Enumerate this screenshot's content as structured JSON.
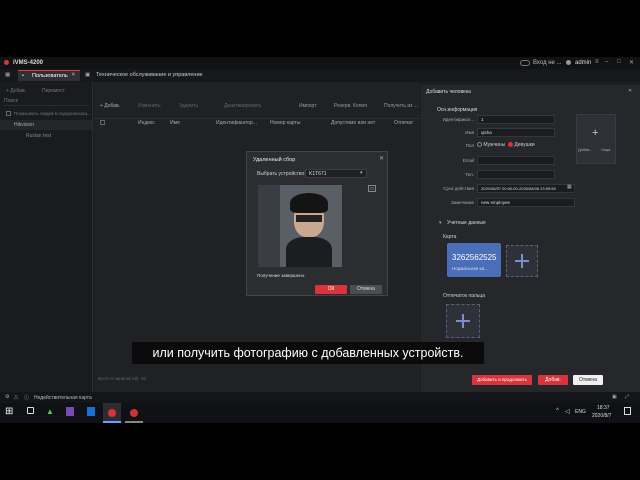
{
  "app": {
    "title": "iVMS-4200",
    "user": "admin",
    "login_status": "Вход не ..."
  },
  "tabs": {
    "active": "Пользователь",
    "maintenance": "Техническое обслуживание и управление"
  },
  "sidebar": {
    "add_label": "+ Добав.",
    "edit_label": "Перемест.",
    "search_placeholder": "Поиск",
    "show_hint": "Показывать людей в подорганизац...",
    "org_root": "Hikvision",
    "org_child": "Ruslan test"
  },
  "toolbar": {
    "add": "+ Добав.",
    "change": "Изменить",
    "remove": "Удалить",
    "disable": "Деактивировать",
    "import": "Импорт",
    "reset": "Резерв. Копия",
    "get": "Получить из ..."
  },
  "table": {
    "columns": [
      "Индекс",
      "Имя",
      "Идентификатор...",
      "Номер карты",
      "Допустимо или нет",
      "Отпечат"
    ]
  },
  "pagination": {
    "summary": "Всего 0 записи(-ей)",
    "per_page": "20"
  },
  "status_bar": {
    "text": "Недействительная карта"
  },
  "dialog": {
    "title": "Удаленный сбор",
    "device_label": "Выбрать устройство:",
    "device_value": "K1T671",
    "status": "Получение завершено.",
    "ok": "ОК",
    "cancel": "Отмена"
  },
  "panel": {
    "title": "Добавить человека",
    "basic_section": "Осн.информация",
    "id_label": "Идентификат...",
    "id_value": "1",
    "name_label": "Имя",
    "name_value": "qisha",
    "gender_label": "Пол",
    "male": "Мужчины",
    "female": "Девушки",
    "email_label": "Email",
    "email_value": "",
    "phone_label": "Тел.",
    "phone_value": "",
    "validity_label": "Срок действия",
    "validity_value": "2020/08/07 00:00:00-2030/08/06 23:59:59",
    "remark_label": "Замечание",
    "remark_value": "new employee",
    "add_face_label": "Добав...",
    "face_suffix": "Лица",
    "credentials_section": "Учетные данные",
    "card_label": "Карта",
    "card_number": "3262562525",
    "card_type": "Нормальная ка...",
    "fingerprint_label": "Отпечаток пальца",
    "btn_add_continue": "Добавить и продолжить",
    "btn_add": "Добав.",
    "btn_cancel": "Отмена"
  },
  "subtitle": "или получить фотографию с добавленных устройств.",
  "taskbar": {
    "language": "ENG",
    "time": "18:37",
    "date": "2020/8/7"
  },
  "colors": {
    "accent": "#d9343c",
    "card": "#4a6fb8",
    "background": "#1c1e21"
  }
}
